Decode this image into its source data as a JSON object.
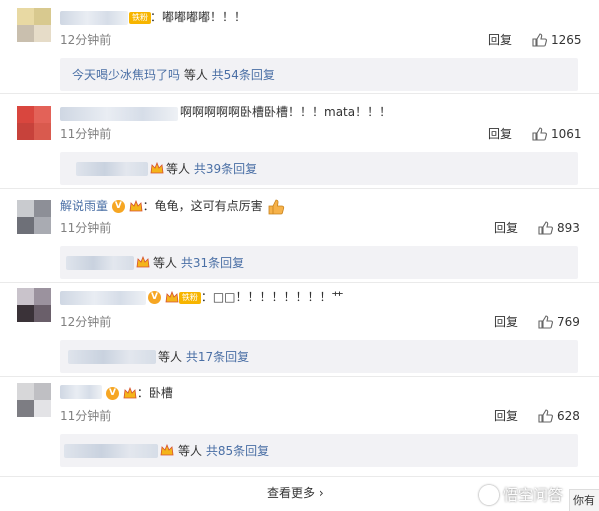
{
  "comments": [
    {
      "text": "：嘟嘟嘟嘟！！！",
      "fan_label": "铁粉",
      "time": "12分钟前",
      "reply_label": "回复",
      "likes": "1265",
      "sub": {
        "prefix": "今天喝少冰焦玛了吗",
        "middle": " 等人 ",
        "link": "共54条回复"
      }
    },
    {
      "text": "啊啊啊啊啊卧槽卧槽！！！mata！！！",
      "time": "11分钟前",
      "reply_label": "回复",
      "likes": "1061",
      "sub": {
        "middle": "等人 ",
        "link": "共39条回复"
      }
    },
    {
      "name": "解说雨童",
      "text": "：龟龟，这可有点厉害",
      "time": "11分钟前",
      "reply_label": "回复",
      "likes": "893",
      "sub": {
        "middle": "等人 ",
        "link": "共31条回复"
      }
    },
    {
      "text": "：□□！！！！！！！！艹",
      "fan_label": "铁粉",
      "time": "12分钟前",
      "reply_label": "回复",
      "likes": "769",
      "sub": {
        "middle": "等人 ",
        "link": "共17条回复"
      }
    },
    {
      "text": "：卧槽",
      "time": "11分钟前",
      "reply_label": "回复",
      "likes": "628",
      "sub": {
        "middle": "等人 ",
        "link": "共85条回复"
      }
    }
  ],
  "more_label": "查看更多 ›",
  "watermark": "悟空问答",
  "corner_text": "你有",
  "colors": {
    "link": "#4a6fa5",
    "sub_bg": "#f2f2f5",
    "badge": "#f6a623"
  },
  "icons": [
    "thumb-up-icon",
    "verified-v-icon",
    "crown-icon",
    "thumbs-emoji-icon"
  ]
}
